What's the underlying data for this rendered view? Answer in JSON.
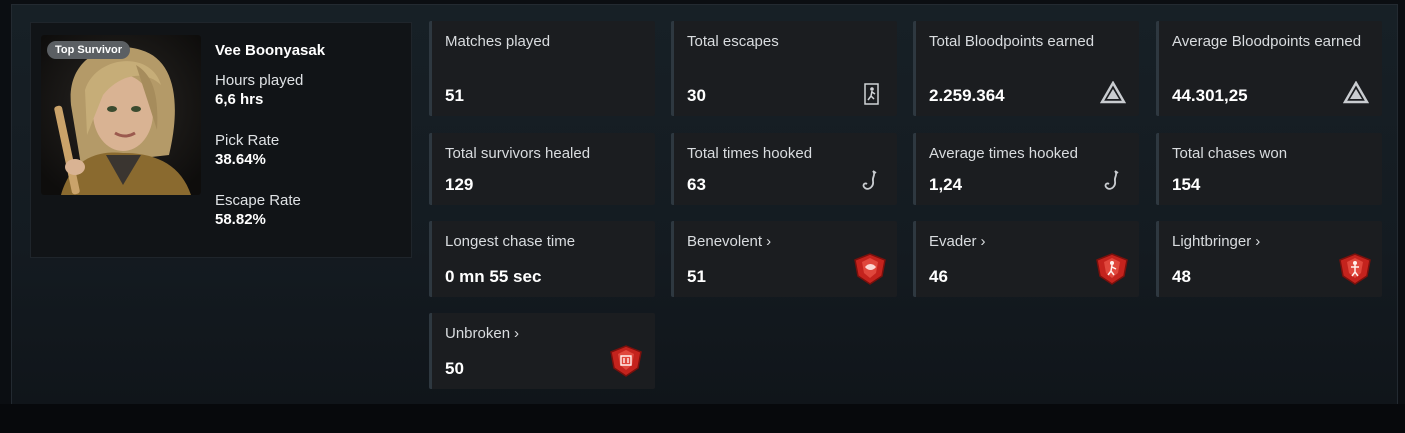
{
  "profile": {
    "badge": "Top Survivor",
    "name": "Vee Boonyasak",
    "stats": [
      {
        "label": "Hours played",
        "value": "6,6 hrs"
      },
      {
        "label": "Pick Rate",
        "value": "38.64%"
      },
      {
        "label": "Escape Rate",
        "value": "58.82%"
      }
    ]
  },
  "cards": [
    {
      "label": "Matches played",
      "value": "51"
    },
    {
      "label": "Total escapes",
      "value": "30",
      "icon": "escape-door-icon"
    },
    {
      "label": "Total Bloodpoints earned",
      "value": "2.259.364",
      "icon": "bloodpoints-icon"
    },
    {
      "label": "Average Bloodpoints earned",
      "value": "44.301,25",
      "icon": "bloodpoints-icon"
    },
    {
      "label": "Total survivors healed",
      "value": "129"
    },
    {
      "label": "Total times hooked",
      "value": "63",
      "icon": "hook-icon"
    },
    {
      "label": "Average times hooked",
      "value": "1,24",
      "icon": "hook-icon"
    },
    {
      "label": "Total chases won",
      "value": "154"
    },
    {
      "label": "Longest chase time",
      "value": "0 mn 55 sec"
    },
    {
      "label": "Benevolent",
      "value": "51",
      "icon": "emblem-icon",
      "link": true
    },
    {
      "label": "Evader",
      "value": "46",
      "icon": "emblem-icon",
      "link": true
    },
    {
      "label": "Lightbringer",
      "value": "48",
      "icon": "emblem-icon",
      "link": true
    },
    {
      "label": "Unbroken",
      "value": "50",
      "icon": "emblem-icon",
      "link": true
    }
  ],
  "chevron": "›",
  "colors": {
    "emblem_red": "#c4231d",
    "card_bg": "#1b1d20",
    "accent_border": "#2e3840"
  }
}
